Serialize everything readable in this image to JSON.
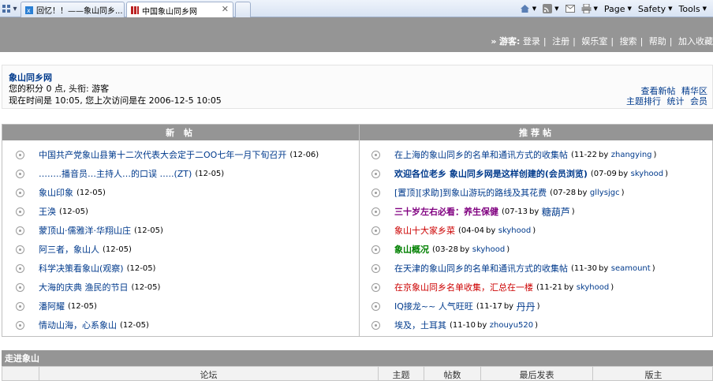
{
  "browser": {
    "tabs": [
      {
        "title": "回忆！！——象山同乡..."
      },
      {
        "title": "中国象山同乡网"
      }
    ],
    "toolbar": {
      "page": "Page",
      "safety": "Safety",
      "tools": "Tools"
    }
  },
  "guestnav": {
    "prefix": "»",
    "label": "游客:",
    "links": [
      "登录",
      "注册",
      "娱乐室",
      "搜索",
      "帮助",
      "加入收藏"
    ]
  },
  "info": {
    "site_title": "象山同乡网",
    "score_line": "您的积分  0 点, 头衔: 游客",
    "time_line": "现在时间是  10:05, 您上次访问是在  2006-12-5 10:05",
    "links_row1": [
      "查看新帖",
      "精华区"
    ],
    "links_row2": [
      "主题排行",
      "统计",
      "会员"
    ]
  },
  "new_posts": {
    "header": "新 帖",
    "items": [
      {
        "title": "中国共产党象山县第十二次代表大会定于二OO七年一月下旬召开",
        "date": "(12-06)"
      },
      {
        "title": "……..播音员…主持人…的口误  …..(ZT)",
        "date": "(12-05)"
      },
      {
        "title": "象山印象",
        "date": "(12-05)"
      },
      {
        "title": "王涣",
        "date": "(12-05)"
      },
      {
        "title": "蒙顶山·儒雅洋·华翔山庄",
        "date": "(12-05)"
      },
      {
        "title": "阿三者，象山人",
        "date": "(12-05)"
      },
      {
        "title": "科学决策看象山(观察)",
        "date": "(12-05)"
      },
      {
        "title": "大海的庆典  渔民的节日",
        "date": "(12-05)"
      },
      {
        "title": "潘阿耀",
        "date": "(12-05)"
      },
      {
        "title": "情动山海，心系象山",
        "date": "(12-05)"
      }
    ]
  },
  "recommended": {
    "header": "推荐帖",
    "items": [
      {
        "title": "在上海的象山同乡的名单和通讯方式的收集帖",
        "date": "(11-22",
        "author": "zhangying",
        "color": "#003a8c",
        "style": ""
      },
      {
        "title": "欢迎各位老乡  象山同乡网是这样创建的(会员浏览)",
        "date": "(07-09",
        "author": "skyhood",
        "color": "#003a8c",
        "style": "bold"
      },
      {
        "title": "[置顶][求助]到象山游玩的路线及其花费",
        "date": "(07-28",
        "author": "gllysjgc",
        "color": "#003a8c",
        "style": ""
      },
      {
        "title": "三十岁左右必看：养生保健",
        "date": "(07-13",
        "author": "糖葫芦",
        "color": "#800080",
        "style": "bold"
      },
      {
        "title": "象山十大家乡菜",
        "date": "(04-04",
        "author": "skyhood",
        "color": "#cc0000",
        "style": ""
      },
      {
        "title": "象山概况",
        "date": "(03-28",
        "author": "skyhood",
        "color": "#008000",
        "style": "bold"
      },
      {
        "title": "在天津的象山同乡的名单和通讯方式的收集帖",
        "date": "(11-30",
        "author": "seamount",
        "color": "#003a8c",
        "style": ""
      },
      {
        "title": "在京象山同乡名单收集，汇总在一楼",
        "date": "(11-21",
        "author": "skyhood",
        "color": "#cc0000",
        "style": ""
      },
      {
        "title": "IQ接龙~~ 人气旺旺",
        "date": "(11-17",
        "author": "丹丹",
        "color": "#003a8c",
        "style": ""
      },
      {
        "title": "埃及，土耳其",
        "date": "(11-10",
        "author": "zhouyu520",
        "color": "#003a8c",
        "style": ""
      }
    ],
    "by_word": "by",
    "close_paren": ")"
  },
  "section": {
    "title": "走进象山",
    "columns": [
      "论坛",
      "主题",
      "帖数",
      "最后发表",
      "版主"
    ]
  },
  "colors": {
    "header_gray": "#959595",
    "link_blue": "#003a8c"
  }
}
